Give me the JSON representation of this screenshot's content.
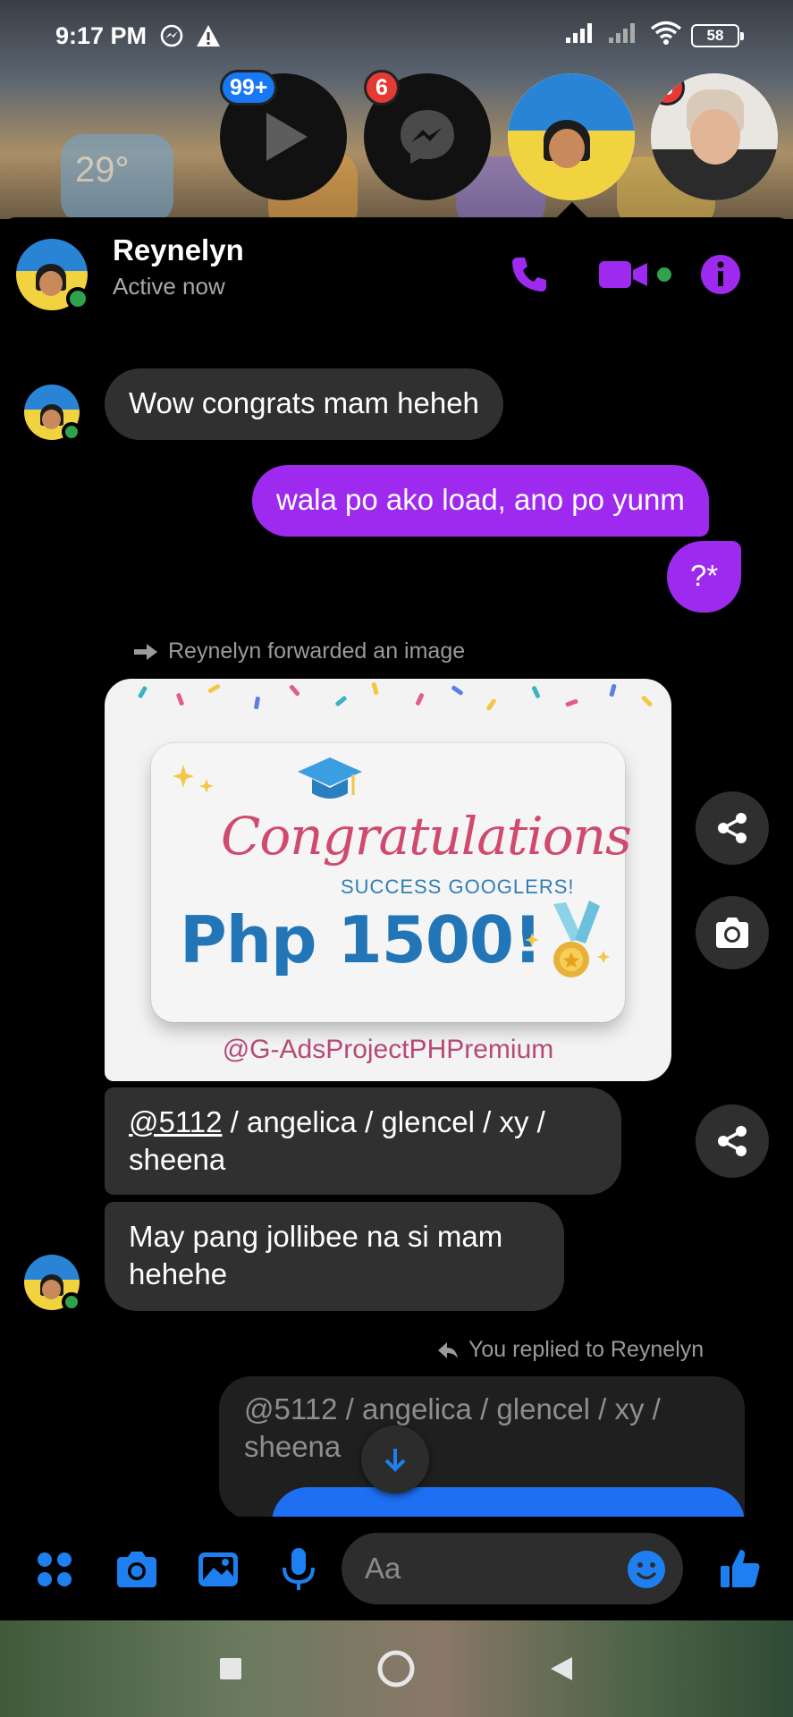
{
  "status_bar": {
    "time": "9:17 PM",
    "battery": "58"
  },
  "home_widget": {
    "temperature": "29°"
  },
  "chat_heads": [
    {
      "name": "video-player-head",
      "badge": "99+",
      "badge_color": "#1877f2"
    },
    {
      "name": "messenger-head",
      "badge": "6",
      "badge_color": "#e53935"
    },
    {
      "name": "reynelyn-head",
      "badge": ""
    },
    {
      "name": "contact-head",
      "badge": "3",
      "badge_color": "#e53935"
    }
  ],
  "header": {
    "contact_name": "Reynelyn",
    "status": "Active now"
  },
  "messages": {
    "m1": "Wow congrats mam heheh",
    "m2": "wala po ako load, ano po yunm",
    "m3": "?*",
    "forward_note": "Reynelyn forwarded an image",
    "image": {
      "title": "Congratulations",
      "subtitle": "SUCCESS GOOGLERS!",
      "amount": "Php 1500!",
      "handle": "@G-AdsProjectPHPremium"
    },
    "m4_mention": "@5112",
    "m4_rest": " / angelica / glencel / xy / sheena",
    "m5": "May pang jollibee na si mam hehehe",
    "reply_note": "You replied to Reynelyn",
    "reply_quote": "@5112 / angelica / glencel / xy / sheena"
  },
  "composer": {
    "placeholder": "Aa"
  },
  "colors": {
    "accent": "#9e2af0",
    "outgoing_bubble": "#9e2af0",
    "incoming_bubble": "#303030",
    "composer_icon": "#1e80f0",
    "online": "#31a24c"
  }
}
